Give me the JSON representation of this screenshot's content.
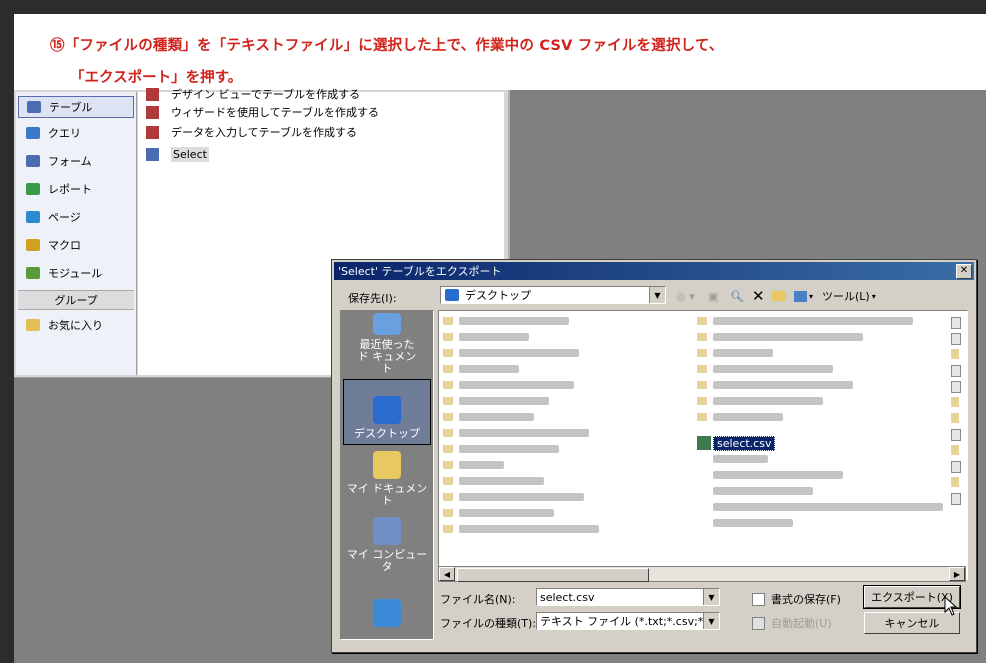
{
  "banner": {
    "line1": "⑮「ファイルの種類」を「テキストファイル」に選択した上で、作業中の CSV ファイルを選択して、",
    "line2": "「エクスポート」を押す。"
  },
  "access": {
    "nav_items": [
      {
        "label": "テーブル",
        "icon": "table-icon",
        "color": "#4a6cb0"
      },
      {
        "label": "クエリ",
        "icon": "query-icon",
        "color": "#3a78c8"
      },
      {
        "label": "フォーム",
        "icon": "form-icon",
        "color": "#4a6cb0"
      },
      {
        "label": "レポート",
        "icon": "report-icon",
        "color": "#3a9a4a"
      },
      {
        "label": "ページ",
        "icon": "page-icon",
        "color": "#2a8ad0"
      },
      {
        "label": "マクロ",
        "icon": "macro-icon",
        "color": "#d0a020"
      },
      {
        "label": "モジュール",
        "icon": "module-icon",
        "color": "#5a9a3a"
      }
    ],
    "group_header": "グループ",
    "favorites": "お気に入り",
    "objects": [
      {
        "label": "デザイン ビューでテーブルを作成する",
        "icon": "wizard-icon"
      },
      {
        "label": "ウィザードを使用してテーブルを作成する",
        "icon": "wizard-icon"
      },
      {
        "label": "データを入力してテーブルを作成する",
        "icon": "wizard-icon"
      },
      {
        "label": "Select",
        "icon": "table-icon"
      }
    ]
  },
  "dialog": {
    "title": "'Select' テーブルをエクスポート",
    "save_in_label": "保存先(I):",
    "save_in_value": "デスクトップ",
    "tools_label": "ツール(L)",
    "places": [
      {
        "label": "最近使ったド キュメント",
        "icon": "recent-icon",
        "color": "#6aa0e0"
      },
      {
        "label": "デスクトップ",
        "icon": "desktop-icon",
        "color": "#2a6bd0"
      },
      {
        "label": "マイ ドキュメント",
        "icon": "my-documents-icon",
        "color": "#e8c860"
      },
      {
        "label": "マイ コンピュータ",
        "icon": "my-computer-icon",
        "color": "#7090c8"
      },
      {
        "label": "",
        "icon": "network-icon",
        "color": "#3a8ad8"
      }
    ],
    "selected_file": "select.csv",
    "filename_label": "ファイル名(N):",
    "filename_value": "select.csv",
    "filetype_label": "ファイルの種類(T):",
    "filetype_value": "テキスト ファイル (*.txt;*.csv;*.tab",
    "save_format_label": "書式の保存(F)",
    "autostart_label": "自動起動(U)",
    "export_button": "エクスポート(X)",
    "cancel_button": "キャンセル"
  }
}
